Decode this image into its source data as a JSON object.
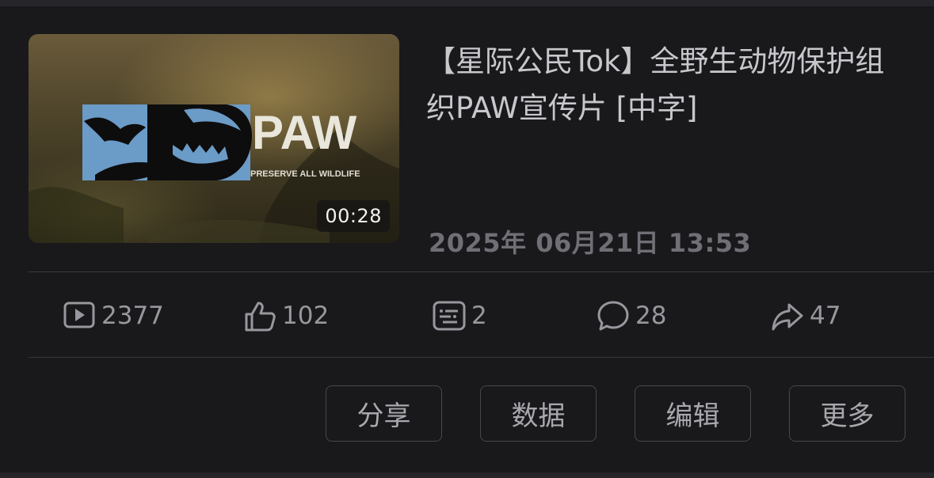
{
  "video": {
    "thumbnail": {
      "logo_text": "PAW",
      "logo_subtext": "PRESERVE ALL WILDLIFE",
      "duration": "00:28"
    },
    "title": "【星际公民Tok】全野生动物保护组织PAW宣传片 [中字]",
    "published": "2025年 06月21日 13:53"
  },
  "stats": {
    "plays": {
      "icon": "play-icon",
      "value": "2377"
    },
    "likes": {
      "icon": "thumbs-up-icon",
      "value": "102"
    },
    "danmaku": {
      "icon": "danmaku-icon",
      "value": "2"
    },
    "comments": {
      "icon": "comment-icon",
      "value": "28"
    },
    "shares": {
      "icon": "share-icon",
      "value": "47"
    }
  },
  "actions": {
    "share": "分享",
    "data": "数据",
    "edit": "编辑",
    "more": "更多"
  },
  "colors": {
    "background": "#19191c",
    "logo_blue": "#6b9bc7"
  }
}
